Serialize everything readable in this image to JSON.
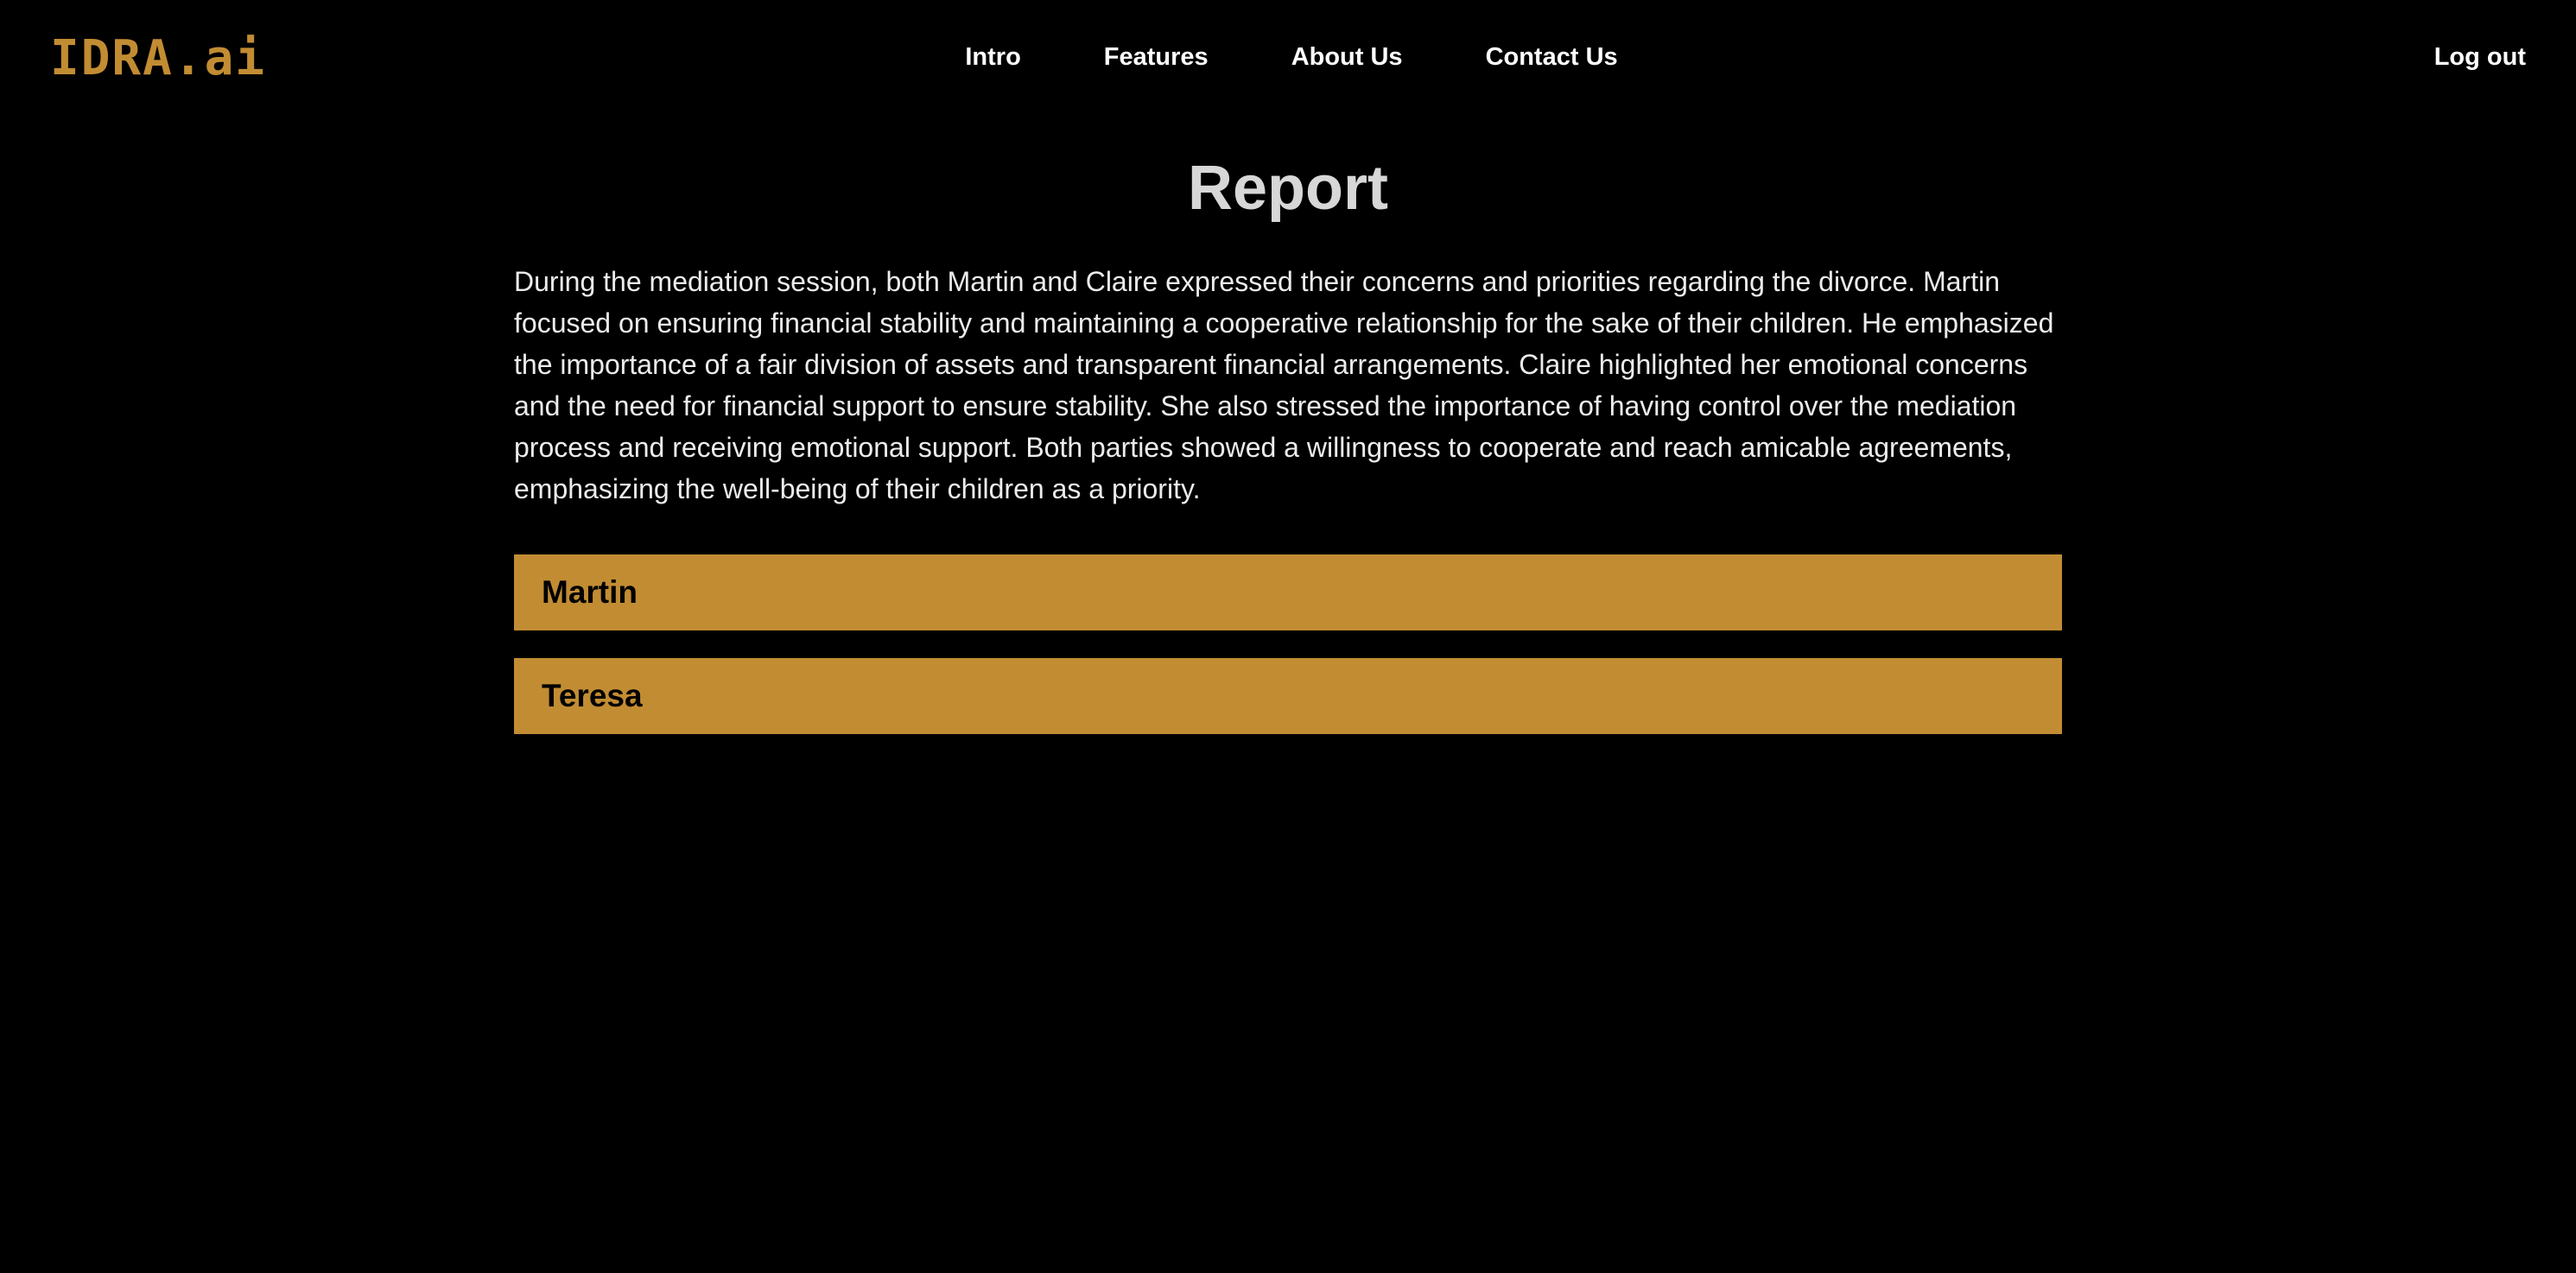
{
  "brand": {
    "logo_text": "IDRA.ai",
    "accent_color": "#c28c33",
    "background_color": "#000000"
  },
  "nav": {
    "items": [
      {
        "label": "Intro"
      },
      {
        "label": "Features"
      },
      {
        "label": "About Us"
      },
      {
        "label": "Contact Us"
      }
    ],
    "logout_label": "Log out"
  },
  "report": {
    "title": "Report",
    "summary": "During the mediation session, both Martin and Claire expressed their concerns and priorities regarding the divorce. Martin focused on ensuring financial stability and maintaining a cooperative relationship for the sake of their children. He emphasized the importance of a fair division of assets and transparent financial arrangements. Claire highlighted her emotional concerns and the need for financial support to ensure stability. She also stressed the importance of having control over the mediation process and receiving emotional support. Both parties showed a willingness to cooperate and reach amicable agreements, emphasizing the well-being of their children as a priority.",
    "parties": [
      {
        "name": "Martin"
      },
      {
        "name": "Teresa"
      }
    ]
  }
}
